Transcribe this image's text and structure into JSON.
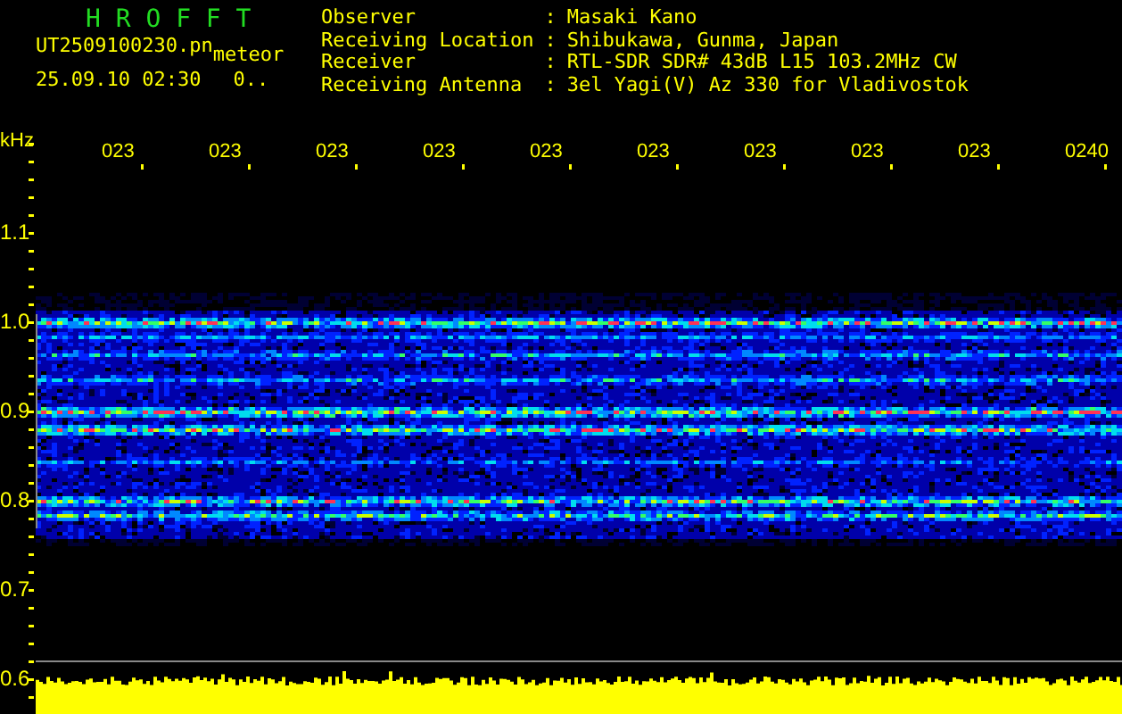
{
  "title": "H R O F F T",
  "file_name": "UT2509100230.pn",
  "meteor_label": "meteor",
  "timestamp": "25.09.10 02:30",
  "count": "0..",
  "info": [
    {
      "label": "Observer",
      "separator": ":",
      "value": "Masaki Kano"
    },
    {
      "label": "Receiving Location",
      "separator": ":",
      "value": "Shibukawa, Gunma, Japan"
    },
    {
      "label": "Receiver",
      "separator": ":",
      "value": "RTL-SDR SDR# 43dB L15 103.2MHz CW"
    },
    {
      "label": "Receiving Antenna",
      "separator": ":",
      "value": "3el Yagi(V) Az 330 for Vladivostok"
    }
  ],
  "y_unit": "kHz",
  "y_ticks": [
    "1.1",
    "1.0",
    "0.9",
    "0.8",
    "0.7",
    "0.6"
  ],
  "time_labels": [
    "023",
    "023",
    "023",
    "023",
    "023",
    "023",
    "023",
    "023",
    "023",
    "0240"
  ]
}
